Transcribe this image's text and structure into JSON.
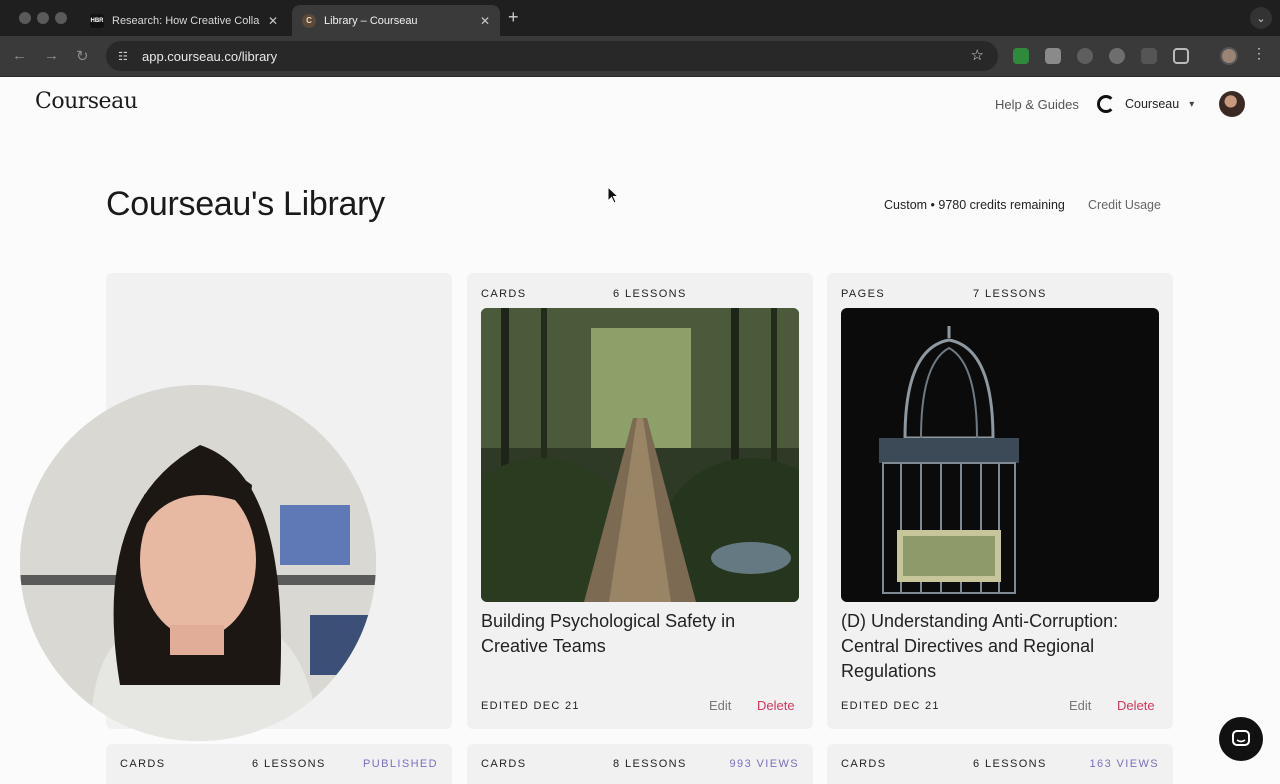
{
  "browser": {
    "tabs": [
      {
        "title": "Research: How Creative Colla",
        "favicon": "HBR",
        "active": false
      },
      {
        "title": "Library – Courseau",
        "favicon": "C",
        "active": true
      }
    ],
    "url": "app.courseau.co/library"
  },
  "header": {
    "logo": "Courseau",
    "help": "Help & Guides",
    "workspace": "Courseau"
  },
  "page": {
    "title": "Courseau's Library",
    "plan": "Custom • 9780 credits remaining",
    "credit_usage": "Credit Usage"
  },
  "cards": [
    {
      "type": "",
      "lessons": "",
      "title": "",
      "edited": "",
      "edit": "",
      "delete": ""
    },
    {
      "type": "CARDS",
      "lessons": "6 LESSONS",
      "title": "Building Psychological Safety in Creative Teams",
      "edited": "EDITED DEC 21",
      "edit": "Edit",
      "delete": "Delete",
      "image": "forest-bridge"
    },
    {
      "type": "PAGES",
      "lessons": "7 LESSONS",
      "title": "(D) Understanding Anti-Corruption: Central Directives and Regional Regulations",
      "edited": "EDITED DEC 21",
      "edit": "Edit",
      "delete": "Delete",
      "image": "birdcage-money"
    }
  ],
  "row2": [
    {
      "type": "CARDS",
      "lessons": "6 LESSONS",
      "stat": "PUBLISHED"
    },
    {
      "type": "CARDS",
      "lessons": "8 LESSONS",
      "stat": "993 VIEWS"
    },
    {
      "type": "CARDS",
      "lessons": "6 LESSONS",
      "stat": "163 VIEWS"
    }
  ],
  "colors": {
    "accent": "#7a6fc0",
    "delete": "#d6365a"
  }
}
